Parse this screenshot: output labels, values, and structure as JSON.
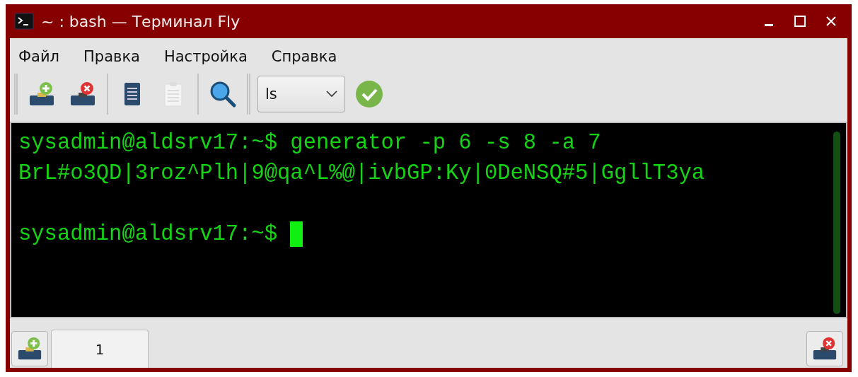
{
  "window": {
    "title": "~ : bash — Терминал Fly"
  },
  "menu": [
    "Файл",
    "Правка",
    "Настройка",
    "Справка"
  ],
  "toolbar": {
    "command": {
      "value": "ls"
    }
  },
  "terminal": {
    "lines": [
      {
        "kind": "text",
        "text": "sysadmin@aldsrv17:~$ generator -p 6 -s 8 -a 7",
        "cursor": false
      },
      {
        "kind": "text",
        "text": "BrL#o3QD|3roz^Plh|9@qa^L%@|ivbGP:Ky|0DeNSQ#5|GgllT3ya",
        "cursor": false
      },
      {
        "kind": "blank",
        "cursor": false
      },
      {
        "kind": "text",
        "text": "sysadmin@aldsrv17:~$",
        "cursor": true
      }
    ]
  },
  "tabs": [
    {
      "label": "1",
      "selected": true
    }
  ]
}
